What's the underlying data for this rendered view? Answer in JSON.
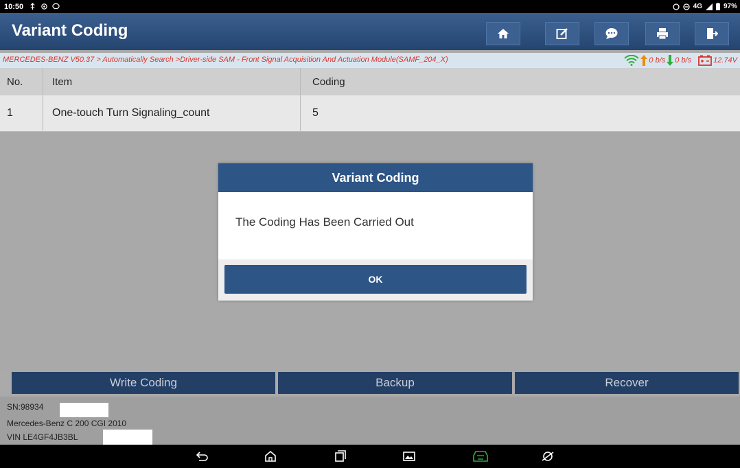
{
  "status_bar": {
    "time": "10:50",
    "network": "4G",
    "battery": "97%"
  },
  "header": {
    "title": "Variant Coding",
    "buttons": [
      "home-icon",
      "edit-icon",
      "chat-icon",
      "print-icon",
      "exit-icon"
    ]
  },
  "breadcrumb": {
    "path": "MERCEDES-BENZ V50.37 > Automatically Search >Driver-side SAM - Front Signal Acquisition And Actuation Module(SAMF_204_X)",
    "upload_rate": "0 b/s",
    "download_rate": "0 b/s",
    "voltage": "12.74V"
  },
  "table": {
    "columns": [
      "No.",
      "Item",
      "Coding"
    ],
    "rows": [
      {
        "no": "1",
        "item": "One-touch Turn Signaling_count",
        "coding": "5"
      }
    ]
  },
  "actions": {
    "write": "Write Coding",
    "backup": "Backup",
    "recover": "Recover"
  },
  "vehicle_info": {
    "sn": "SN:98934",
    "model": "Mercedes-Benz C 200 CGI 2010",
    "vin": "VIN LE4GF4JB3BL"
  },
  "dialog": {
    "title": "Variant Coding",
    "message": "The Coding Has Been Carried Out",
    "ok": "OK"
  },
  "colors": {
    "header_blue": "#2d5586",
    "breadcrumb_red": "#d9342b",
    "button_navy": "#243f66",
    "wifi_green": "#2fae3a",
    "upload_orange": "#f08a00"
  }
}
